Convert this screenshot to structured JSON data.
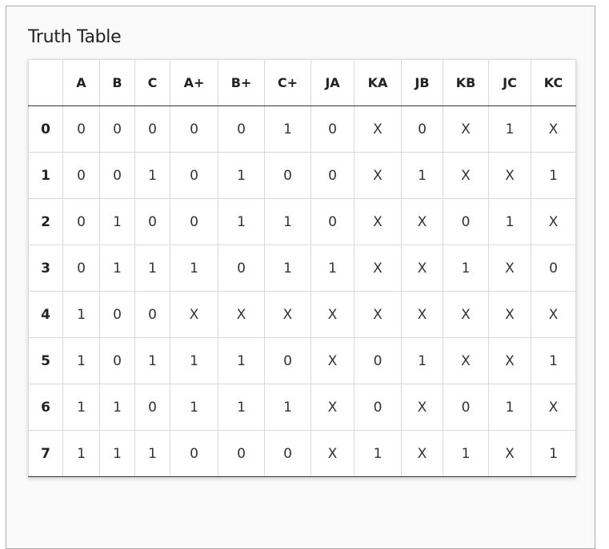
{
  "title": "Truth Table",
  "columns": [
    "",
    "A",
    "B",
    "C",
    "A+",
    "B+",
    "C+",
    "JA",
    "KA",
    "JB",
    "KB",
    "JC",
    "KC"
  ],
  "rows": [
    {
      "index": "0",
      "cells": [
        "0",
        "0",
        "0",
        "0",
        "0",
        "1",
        "0",
        "X",
        "0",
        "X",
        "1",
        "X"
      ]
    },
    {
      "index": "1",
      "cells": [
        "0",
        "0",
        "1",
        "0",
        "1",
        "0",
        "0",
        "X",
        "1",
        "X",
        "X",
        "1"
      ]
    },
    {
      "index": "2",
      "cells": [
        "0",
        "1",
        "0",
        "0",
        "1",
        "1",
        "0",
        "X",
        "X",
        "0",
        "1",
        "X"
      ]
    },
    {
      "index": "3",
      "cells": [
        "0",
        "1",
        "1",
        "1",
        "0",
        "1",
        "1",
        "X",
        "X",
        "1",
        "X",
        "0"
      ]
    },
    {
      "index": "4",
      "cells": [
        "1",
        "0",
        "0",
        "X",
        "X",
        "X",
        "X",
        "X",
        "X",
        "X",
        "X",
        "X"
      ]
    },
    {
      "index": "5",
      "cells": [
        "1",
        "0",
        "1",
        "1",
        "1",
        "0",
        "X",
        "0",
        "1",
        "X",
        "X",
        "1"
      ]
    },
    {
      "index": "6",
      "cells": [
        "1",
        "1",
        "0",
        "1",
        "1",
        "1",
        "X",
        "0",
        "X",
        "0",
        "1",
        "X"
      ]
    },
    {
      "index": "7",
      "cells": [
        "1",
        "1",
        "1",
        "0",
        "0",
        "0",
        "X",
        "1",
        "X",
        "1",
        "X",
        "1"
      ]
    }
  ]
}
